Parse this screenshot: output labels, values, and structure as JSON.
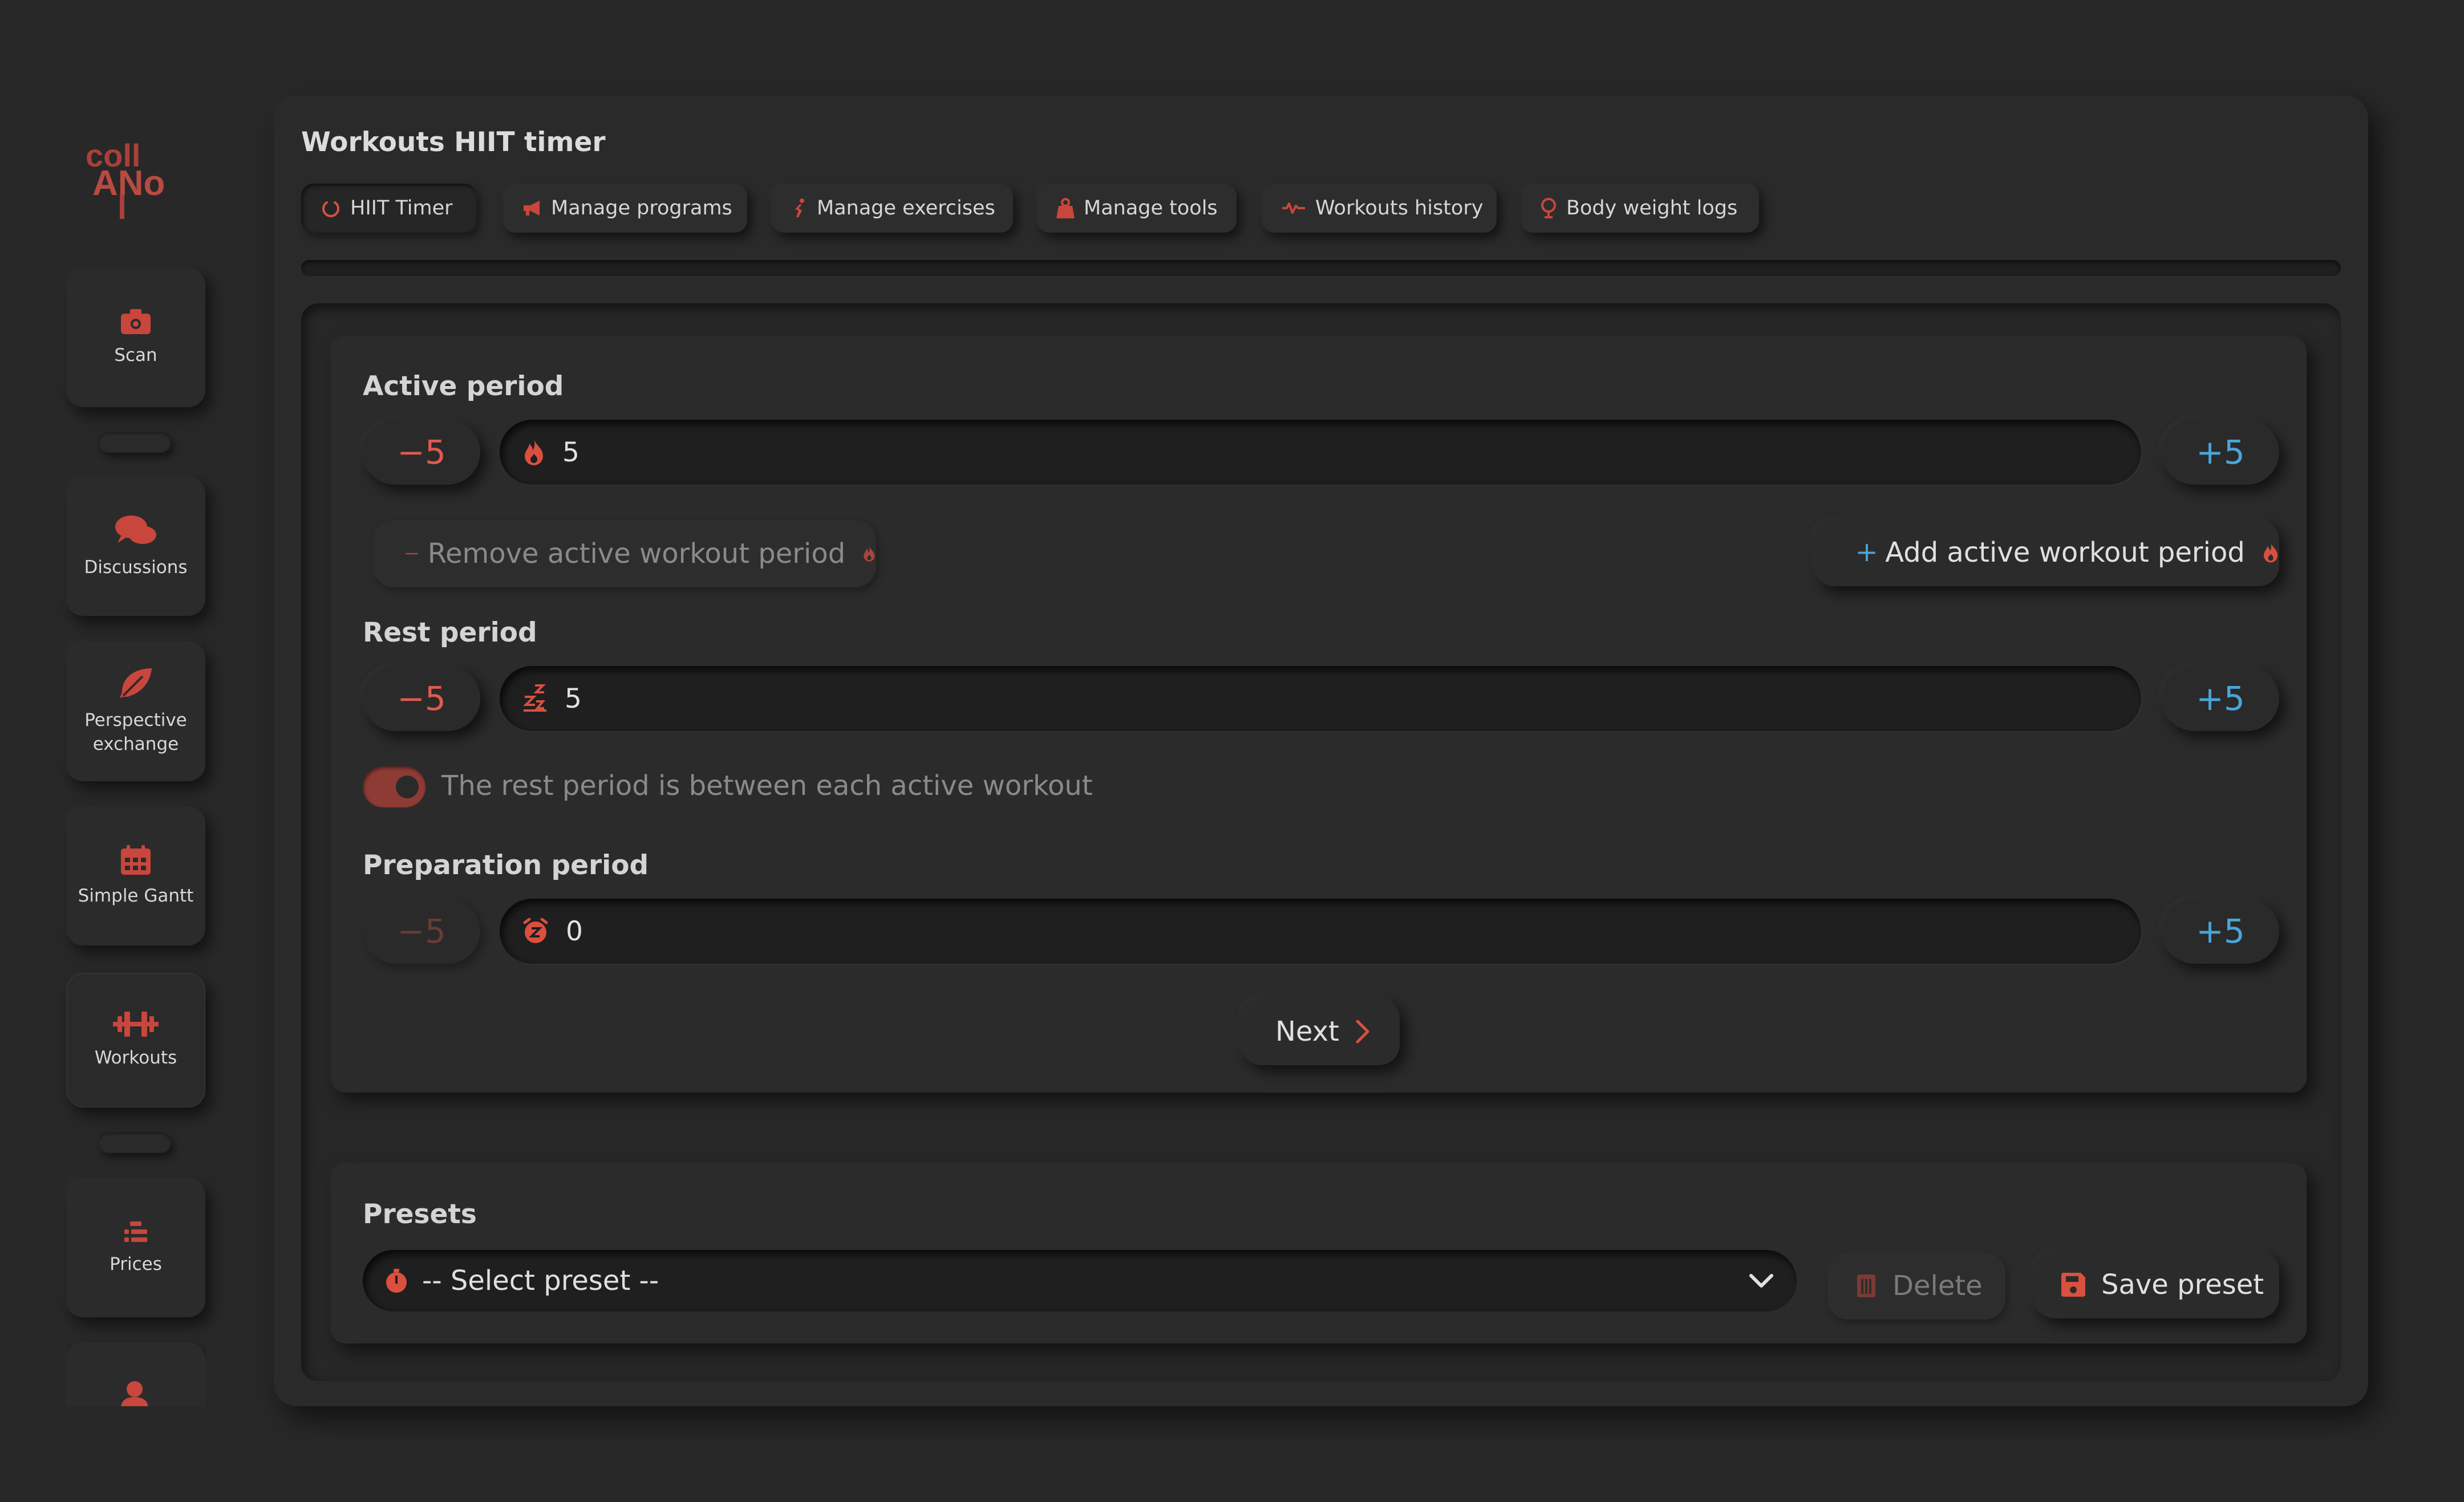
{
  "app": {
    "logo_text_top": "coll",
    "logo_text_bottom": "ANo"
  },
  "sidebar": {
    "items": [
      {
        "label": "Scan",
        "icon": "camera-icon"
      },
      {
        "label": "Discussions",
        "icon": "comments-icon"
      },
      {
        "label": "Perspective exchange",
        "icon": "feather-icon"
      },
      {
        "label": "Simple Gantt",
        "icon": "calendar-icon"
      },
      {
        "label": "Workouts",
        "icon": "dumbbell-icon"
      },
      {
        "label": "Prices",
        "icon": "list-icon"
      }
    ]
  },
  "page": {
    "title": "Workouts HIIT timer"
  },
  "tabs": [
    {
      "label": "HIIT Timer",
      "icon": "power-icon"
    },
    {
      "label": "Manage programs",
      "icon": "megaphone-icon"
    },
    {
      "label": "Manage exercises",
      "icon": "runner-icon"
    },
    {
      "label": "Manage tools",
      "icon": "weight-icon"
    },
    {
      "label": "Workouts history",
      "icon": "wave-icon"
    },
    {
      "label": "Body weight logs",
      "icon": "scale-icon"
    }
  ],
  "active_period": {
    "label": "Active period",
    "minus_label": "−5",
    "plus_label": "+5",
    "value": "5",
    "remove_label": "Remove active workout period",
    "add_label": "Add active workout period"
  },
  "rest_period": {
    "label": "Rest period",
    "minus_label": "−5",
    "plus_label": "+5",
    "value": "5",
    "toggle_text": "The rest period is between each active workout"
  },
  "preparation_period": {
    "label": "Preparation period",
    "minus_label": "−5",
    "plus_label": "+5",
    "value": "0"
  },
  "next_label": "Next",
  "presets": {
    "label": "Presets",
    "select_placeholder": "-- Select preset --",
    "delete_label": "Delete",
    "save_label": "Save preset"
  },
  "colors": {
    "accent_red": "#e05a4e",
    "accent_blue": "#49a6d9",
    "background": "#282828"
  }
}
